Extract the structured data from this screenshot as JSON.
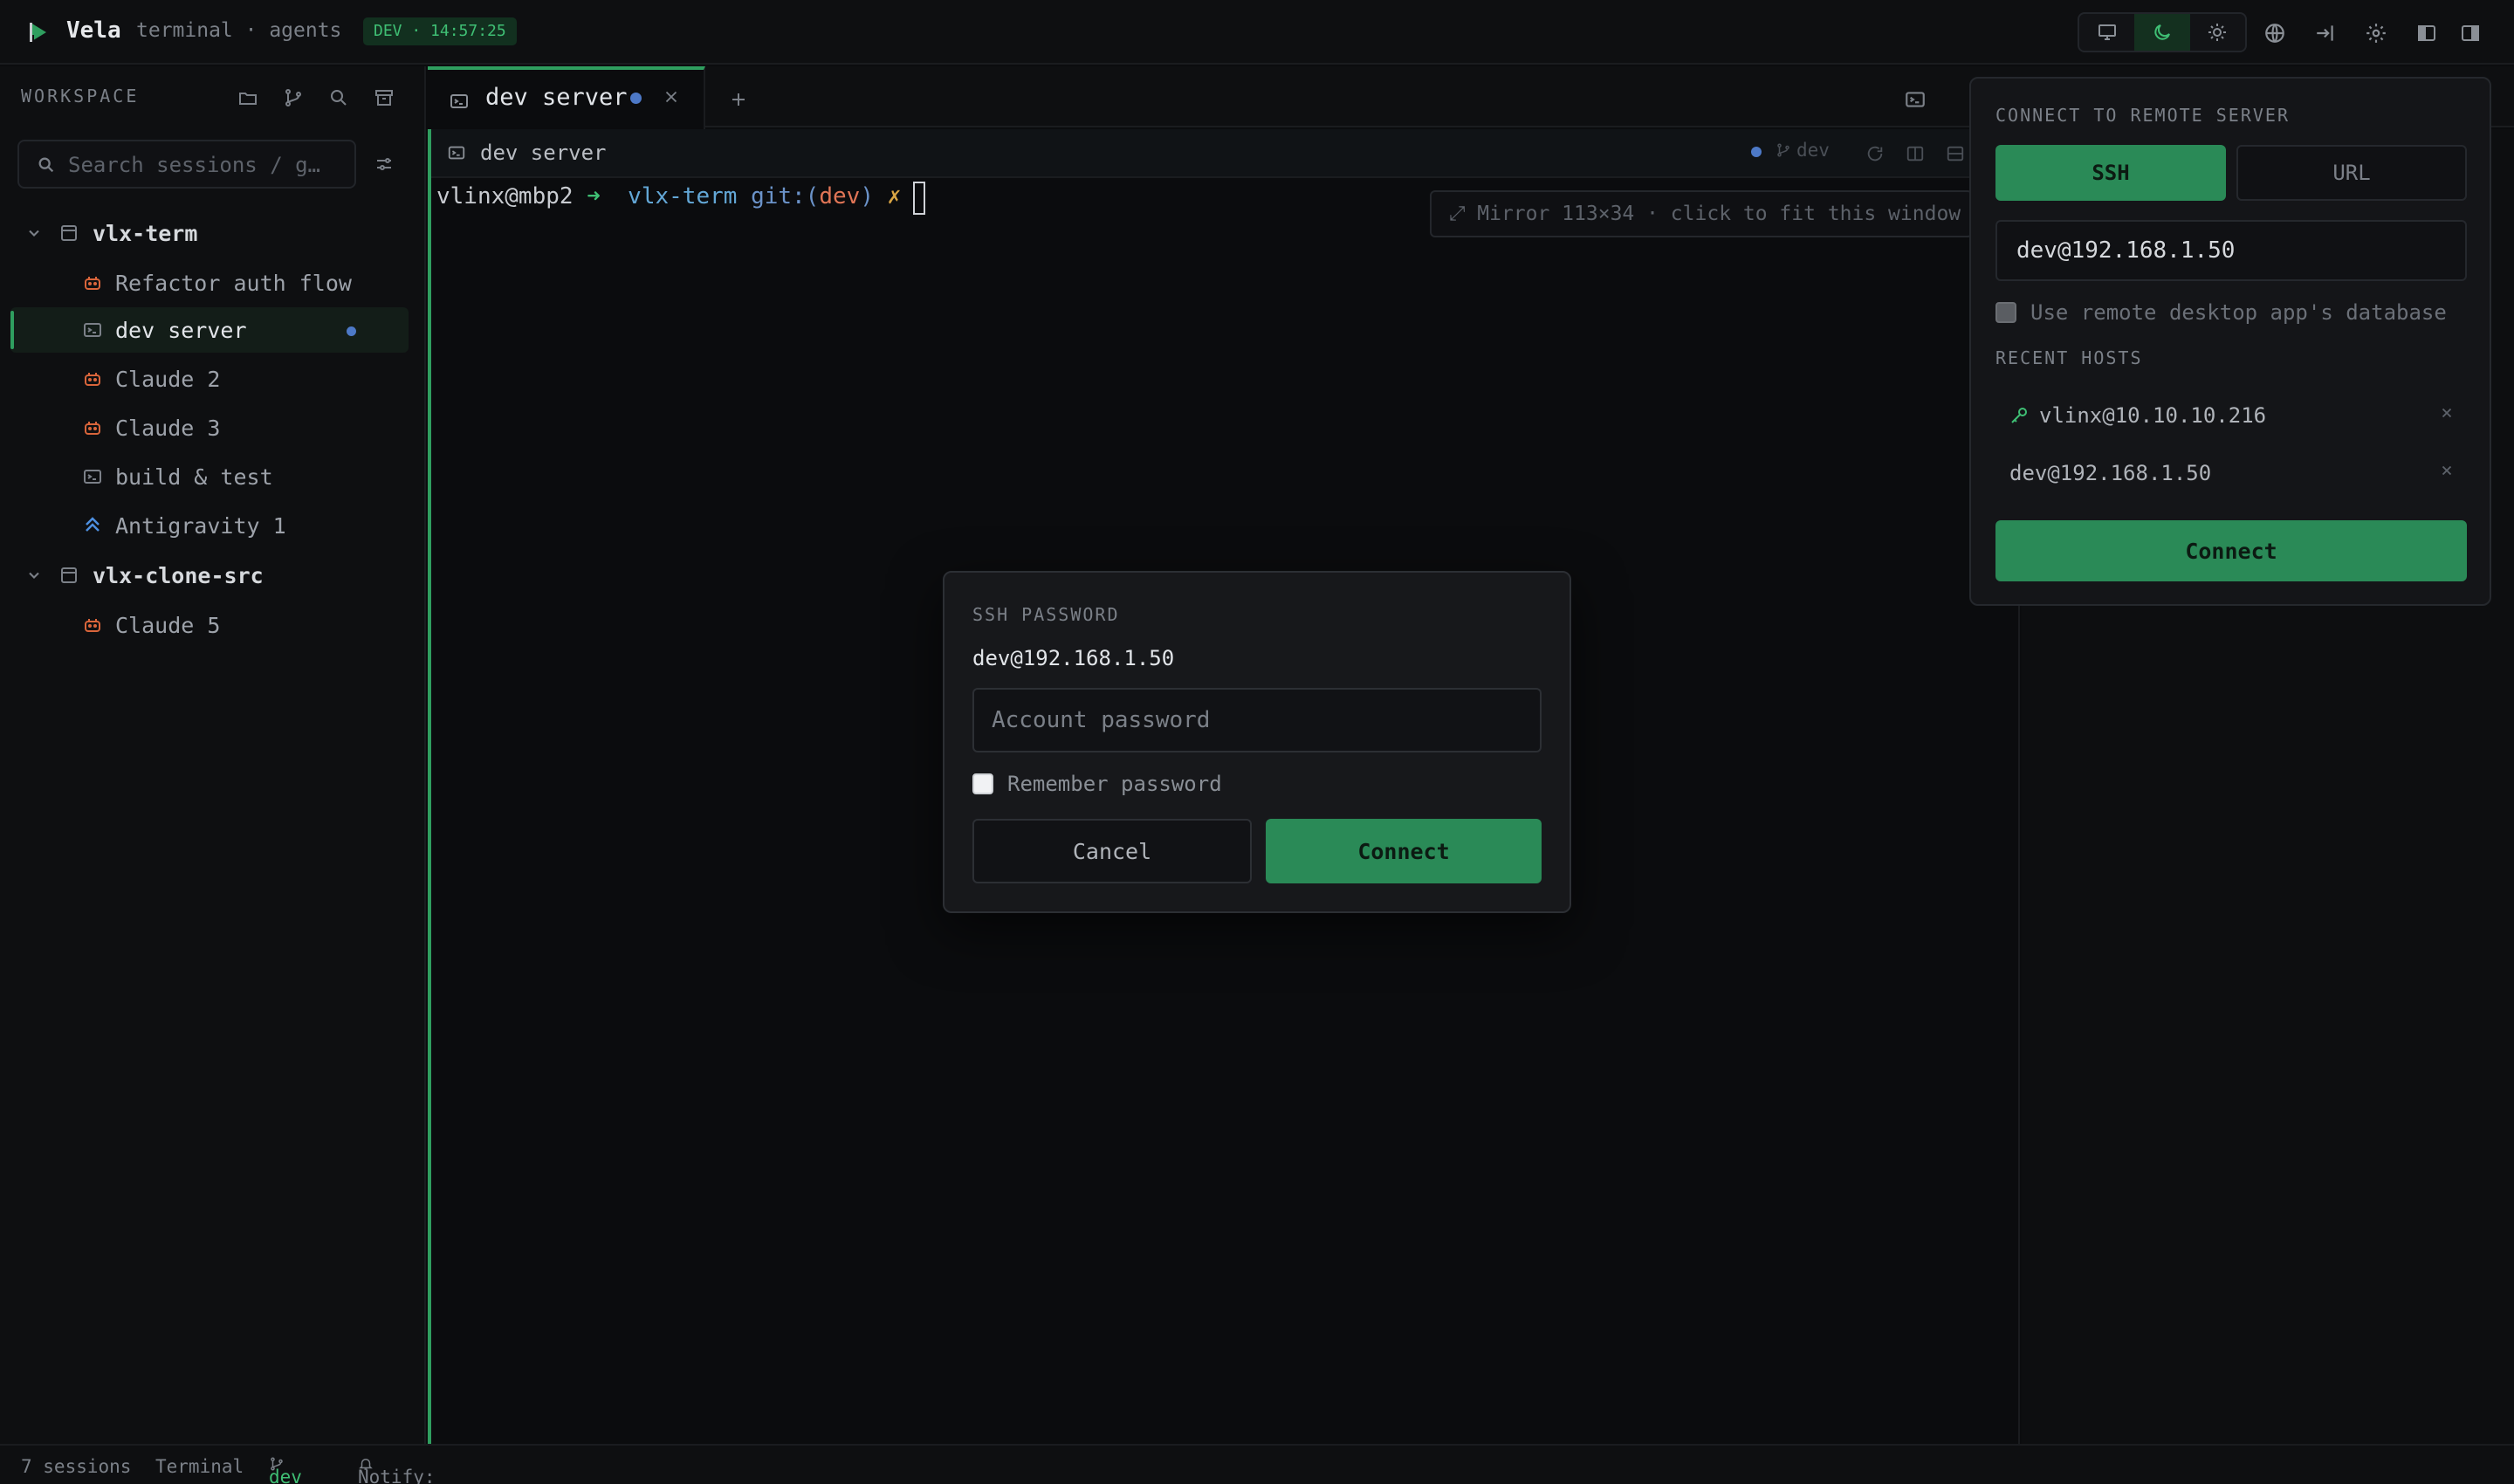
{
  "app": {
    "name": "Vela",
    "subtitle": "terminal · agents",
    "badge": "DEV · 14:57:25"
  },
  "colors": {
    "accent": "#2f9e5f",
    "button_green": "#2a8a57",
    "session_dot": "#4d79c7",
    "claude_icon": "#d9653b",
    "antigravity_icon": "#4d8fe0"
  },
  "sidebar": {
    "label": "WORKSPACE",
    "search_placeholder": "Search sessions / g…",
    "groups": [
      {
        "name": "vlx-term",
        "items": [
          {
            "label": "Refactor auth flow",
            "icon": "claude-icon"
          },
          {
            "label": "dev server",
            "icon": "terminal-icon",
            "active": true
          },
          {
            "label": "Claude 2",
            "icon": "claude-icon"
          },
          {
            "label": "Claude 3",
            "icon": "claude-icon"
          },
          {
            "label": "build & test",
            "icon": "terminal-icon"
          },
          {
            "label": "Antigravity 1",
            "icon": "antigravity-icon"
          }
        ]
      },
      {
        "name": "vlx-clone-src",
        "items": [
          {
            "label": "Claude 5",
            "icon": "claude-icon"
          }
        ]
      }
    ]
  },
  "tabs": [
    {
      "label": "dev server",
      "active": true
    }
  ],
  "pane": {
    "title": "dev server",
    "branch": "dev",
    "prompt": {
      "user": "vlinx@mbp2",
      "arrow": "➜",
      "dir": "vlx-term",
      "git_prefix": "git:(",
      "branch": "dev",
      "git_suffix": ")",
      "dirty": "✗"
    },
    "mirror_hint": "⤢ Mirror 113×34 · click to fit this window"
  },
  "remote": {
    "title": "CONNECT TO REMOTE SERVER",
    "mode_ssh": "SSH",
    "mode_url": "URL",
    "host_value": "dev@192.168.1.50",
    "use_db_label": "Use remote desktop app's database",
    "recent_title": "RECENT HOSTS",
    "recent_hosts": [
      {
        "host": "vlinx@10.10.10.216",
        "icon": "key-icon"
      },
      {
        "host": "dev@192.168.1.50"
      }
    ],
    "connect_label": "Connect"
  },
  "modal": {
    "title": "SSH PASSWORD",
    "host": "dev@192.168.1.50",
    "password_placeholder": "Account password",
    "remember_label": "Remember password",
    "cancel_label": "Cancel",
    "connect_label": "Connect"
  },
  "statusbar": {
    "sessions": "7 sessions",
    "mode": "Terminal",
    "branch": "dev",
    "notify": "Notify: On"
  }
}
